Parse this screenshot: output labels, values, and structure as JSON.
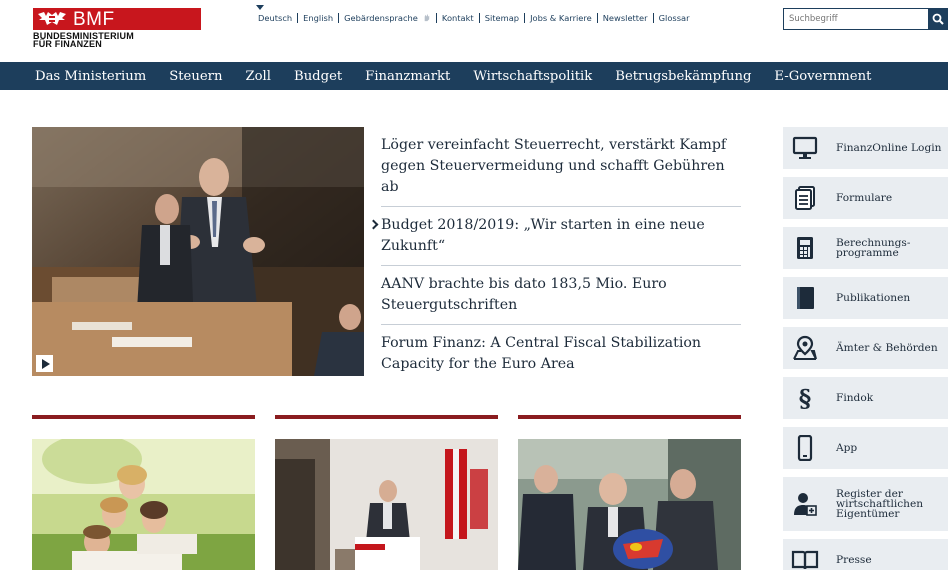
{
  "brand": {
    "logo_text": "BMF",
    "sub_line1": "BUNDESMINISTERIUM",
    "sub_line2": "FÜR FINANZEN"
  },
  "service_nav": [
    "Deutsch",
    "English",
    "Gebärdensprache",
    "Kontakt",
    "Sitemap",
    "Jobs & Karriere",
    "Newsletter",
    "Glossar"
  ],
  "search": {
    "placeholder": "Suchbegriff"
  },
  "main_nav": [
    "Das Ministerium",
    "Steuern",
    "Zoll",
    "Budget",
    "Finanzmarkt",
    "Wirtschaftspolitik",
    "Betrugsbekämpfung",
    "E-Government"
  ],
  "news": [
    {
      "title": "Löger vereinfacht Steuerrecht, verstärkt Kampf gegen Steuervermeidung und schafft Gebühren ab",
      "active": false
    },
    {
      "title": "Budget 2018/2019: „Wir starten in eine neue Zukunft“",
      "active": true
    },
    {
      "title": "AANV brachte bis dato 183,5 Mio. Euro Steuergutschriften",
      "active": false
    },
    {
      "title": "Forum Finanz: A Central Fiscal Stabilization Capacity for the Euro Area",
      "active": false
    }
  ],
  "sidebar": [
    {
      "label": "FinanzOnline Login",
      "icon": "monitor-icon"
    },
    {
      "label": "Formulare",
      "icon": "documents-icon"
    },
    {
      "label": "Berechnungs-programme",
      "icon": "calculator-icon"
    },
    {
      "label": "Publikationen",
      "icon": "book-icon"
    },
    {
      "label": "Ämter & Behörden",
      "icon": "map-pin-icon"
    },
    {
      "label": "Findok",
      "icon": "paragraph-icon"
    },
    {
      "label": "App",
      "icon": "smartphone-icon"
    },
    {
      "label": "Register der wirtschaftlichen Eigentümer",
      "icon": "person-register-icon"
    },
    {
      "label": "Presse",
      "icon": "open-book-icon"
    }
  ],
  "colors": {
    "brand_red": "#c8161d",
    "nav_blue": "#1d3e5c",
    "teaser_bar": "#8a1c1f",
    "sidebar_bg": "#e9edf1"
  }
}
